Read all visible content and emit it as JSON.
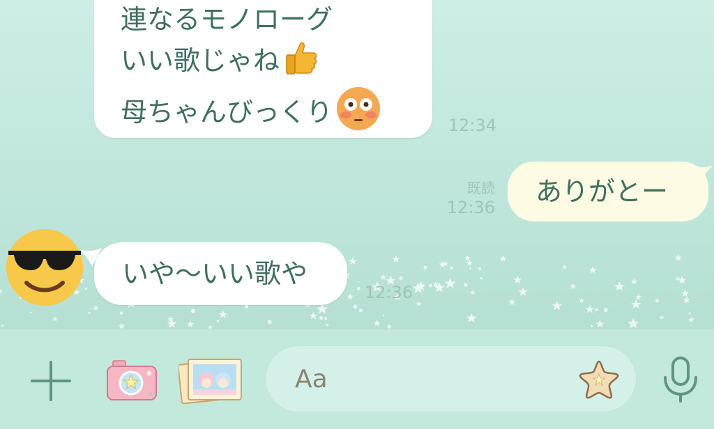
{
  "messages": {
    "incoming_1": {
      "lines": [
        "連なるモノローグ",
        "いい歌じゃね",
        "母ちゃんびっくり"
      ],
      "time": "12:34"
    },
    "outgoing_1": {
      "text": "ありがとー",
      "read_label": "既読",
      "time": "12:36"
    },
    "incoming_2": {
      "text": "いや〜いい歌や",
      "time": "12:36"
    }
  },
  "input": {
    "placeholder": "Aa"
  },
  "toolbar": {
    "icons": [
      "plus-icon",
      "camera-icon",
      "photo-album-icon",
      "sticker-icon",
      "microphone-icon"
    ]
  },
  "colors": {
    "background": "#c3e9dd",
    "outgoing_bubble": "#fdfbe3",
    "incoming_bubble": "#ffffff",
    "text": "#3f6f61",
    "meta": "#9fc4b8"
  }
}
